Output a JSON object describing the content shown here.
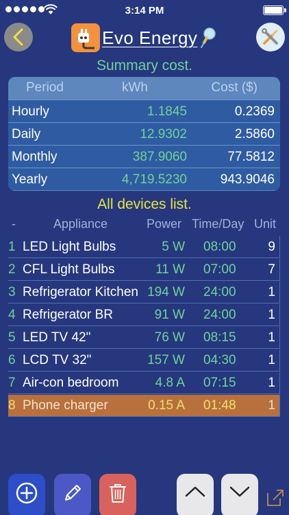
{
  "status_bar": {
    "time": "3:14 PM"
  },
  "header": {
    "title": "Evo Energy"
  },
  "summary": {
    "title": "Summary cost.",
    "headers": {
      "period": "Period",
      "kwh": "kWh",
      "cost": "Cost ($)"
    },
    "rows": [
      {
        "period": "Hourly",
        "kwh": "1.1845",
        "cost": "0.2369"
      },
      {
        "period": "Daily",
        "kwh": "12.9302",
        "cost": "2.5860"
      },
      {
        "period": "Monthly",
        "kwh": "387.9060",
        "cost": "77.5812"
      },
      {
        "period": "Yearly",
        "kwh": "4,719.5230",
        "cost": "943.9046"
      }
    ]
  },
  "devices": {
    "title": "All devices list.",
    "headers": {
      "num": "-",
      "appliance": "Appliance",
      "power": "Power",
      "time": "Time/Day",
      "unit": "Unit"
    },
    "rows": [
      {
        "num": "1",
        "name": "LED Light Bulbs",
        "power": "5 W",
        "time": "08:00",
        "unit": "9"
      },
      {
        "num": "2",
        "name": "CFL Light Bulbs",
        "power": "11 W",
        "time": "07:00",
        "unit": "7"
      },
      {
        "num": "3",
        "name": "Refrigerator Kitchen",
        "power": "194 W",
        "time": "24:00",
        "unit": "1"
      },
      {
        "num": "4",
        "name": "Refrigerator BR",
        "power": "91 W",
        "time": "24:00",
        "unit": "1"
      },
      {
        "num": "5",
        "name": "LED TV 42\"",
        "power": "76 W",
        "time": "08:15",
        "unit": "1"
      },
      {
        "num": "6",
        "name": "LCD TV 32\"",
        "power": "157 W",
        "time": "04:30",
        "unit": "1"
      },
      {
        "num": "7",
        "name": "Air-con bedroom",
        "power": "4.8 A",
        "time": "07:15",
        "unit": "1"
      },
      {
        "num": "8",
        "name": "Phone charger",
        "power": "0.15 A",
        "time": "01:48",
        "unit": "1"
      }
    ],
    "selected_index": 7
  },
  "icons": {
    "back": "chevron-left-icon",
    "settings": "tools-icon",
    "logo": "plug-icon",
    "bulb": "lightbulb-icon",
    "add": "plus-circle-icon",
    "edit": "pencil-icon",
    "delete": "trash-icon",
    "up": "chevron-up-icon",
    "down": "chevron-down-icon",
    "share": "share-icon"
  },
  "colors": {
    "background": "#26377e",
    "accent_green": "#6fd39a",
    "accent_yellow": "#e6e43e",
    "selected_row": "#b8703d"
  }
}
